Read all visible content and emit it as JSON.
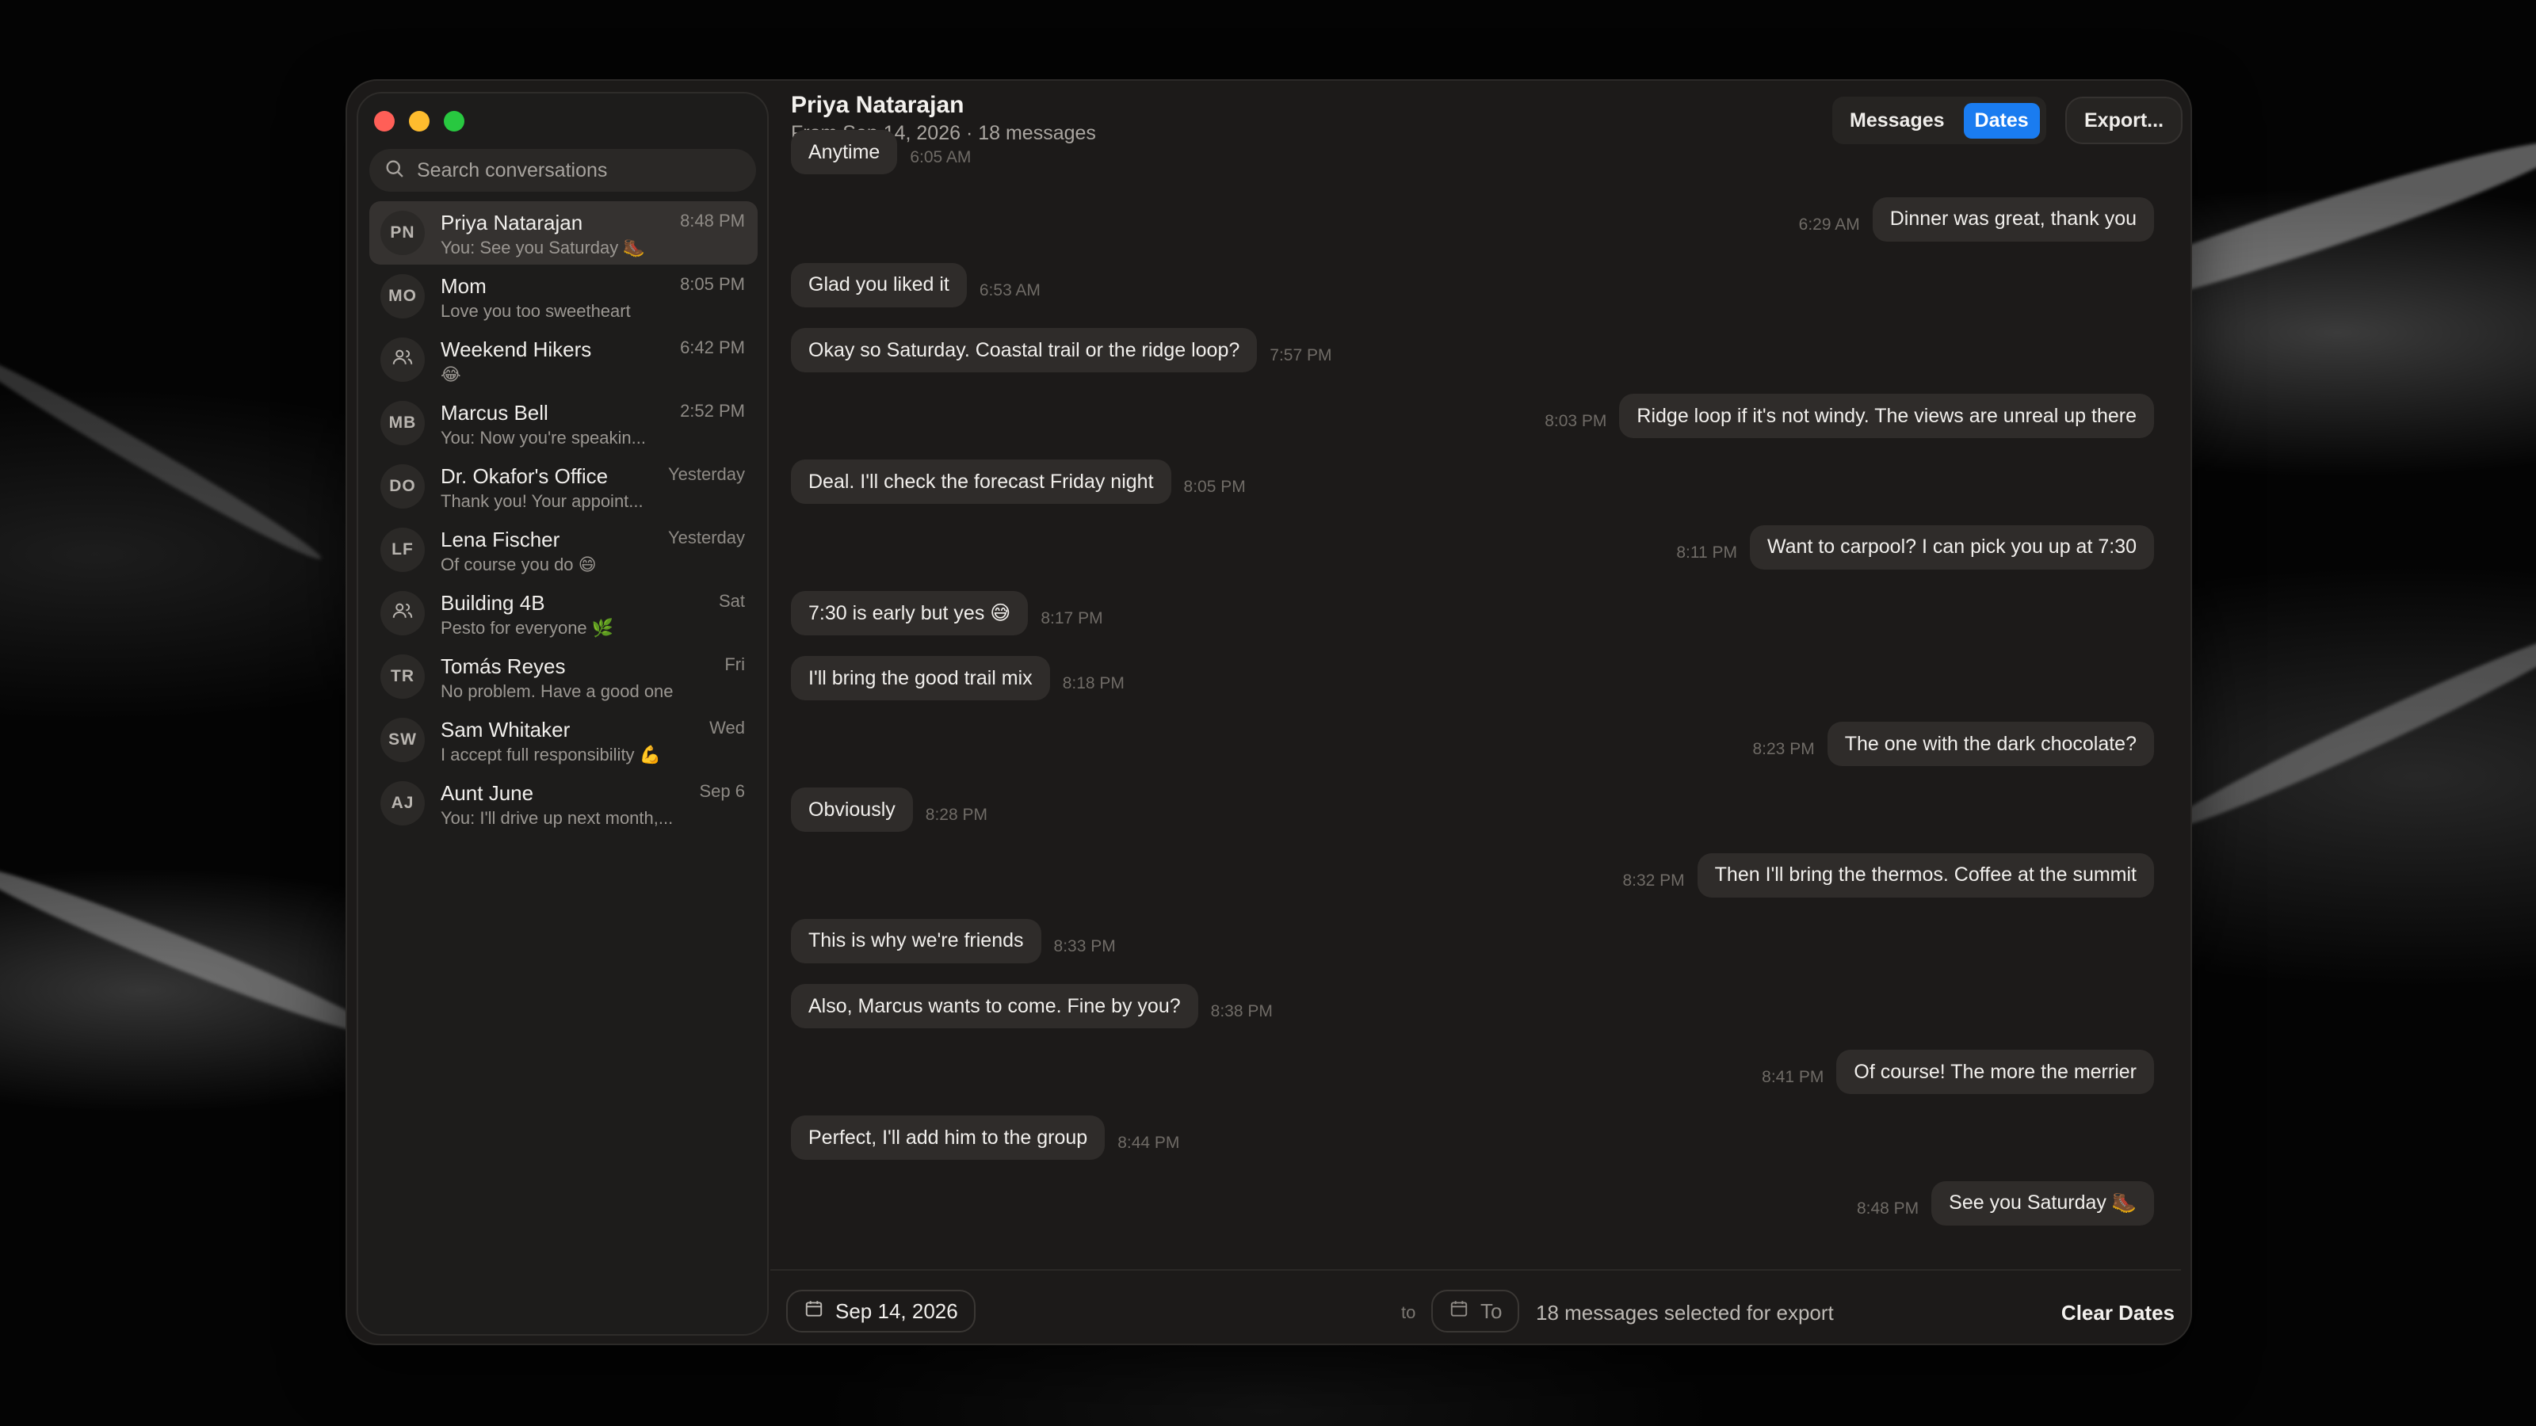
{
  "sidebar": {
    "search_placeholder": "Search conversations",
    "conversations": [
      {
        "initials": "PN",
        "name": "Priya Natarajan",
        "time": "8:48 PM",
        "preview": "You: See you Saturday 🥾",
        "active": true,
        "group": false
      },
      {
        "initials": "MO",
        "name": "Mom",
        "time": "8:05 PM",
        "preview": "Love you too sweetheart",
        "group": false
      },
      {
        "initials": "",
        "name": "Weekend Hikers",
        "time": "6:42 PM",
        "preview": "😂",
        "group": true
      },
      {
        "initials": "MB",
        "name": "Marcus Bell",
        "time": "2:52 PM",
        "preview": "You: Now you're speakin...",
        "group": false
      },
      {
        "initials": "DO",
        "name": "Dr. Okafor's Office",
        "time": "Yesterday",
        "preview": "Thank you! Your appoint...",
        "group": false
      },
      {
        "initials": "LF",
        "name": "Lena Fischer",
        "time": "Yesterday",
        "preview": "Of course you do 😄",
        "group": false
      },
      {
        "initials": "",
        "name": "Building 4B",
        "time": "Sat",
        "preview": "Pesto for everyone 🌿",
        "group": true
      },
      {
        "initials": "TR",
        "name": "Tomás Reyes",
        "time": "Fri",
        "preview": "No problem. Have a good one",
        "group": false
      },
      {
        "initials": "SW",
        "name": "Sam Whitaker",
        "time": "Wed",
        "preview": "I accept full responsibility 💪",
        "group": false
      },
      {
        "initials": "AJ",
        "name": "Aunt June",
        "time": "Sep 6",
        "preview": "You: I'll drive up next month,...",
        "group": false
      }
    ]
  },
  "header": {
    "title": "Priya Natarajan",
    "subtitle": "From Sep 14, 2026 · 18 messages",
    "tab_messages": "Messages",
    "tab_dates": "Dates",
    "export_label": "Export..."
  },
  "messages": [
    {
      "dir": "in",
      "text": "Anytime",
      "time": "6:05 AM"
    },
    {
      "dir": "out",
      "text": "Dinner was great, thank you",
      "time": "6:29 AM"
    },
    {
      "dir": "in",
      "text": "Glad you liked it",
      "time": "6:53 AM"
    },
    {
      "dir": "in",
      "text": "Okay so Saturday. Coastal trail or the ridge loop?",
      "time": "7:57 PM"
    },
    {
      "dir": "out",
      "text": "Ridge loop if it's not windy. The views are unreal up there",
      "time": "8:03 PM"
    },
    {
      "dir": "in",
      "text": "Deal. I'll check the forecast Friday night",
      "time": "8:05 PM"
    },
    {
      "dir": "out",
      "text": "Want to carpool? I can pick you up at 7:30",
      "time": "8:11 PM"
    },
    {
      "dir": "in",
      "text": "7:30 is early but yes 😅",
      "time": "8:17 PM"
    },
    {
      "dir": "in",
      "text": "I'll bring the good trail mix",
      "time": "8:18 PM"
    },
    {
      "dir": "out",
      "text": "The one with the dark chocolate?",
      "time": "8:23 PM"
    },
    {
      "dir": "in",
      "text": "Obviously",
      "time": "8:28 PM"
    },
    {
      "dir": "out",
      "text": "Then I'll bring the thermos. Coffee at the summit",
      "time": "8:32 PM"
    },
    {
      "dir": "in",
      "text": "This is why we're friends",
      "time": "8:33 PM"
    },
    {
      "dir": "in",
      "text": "Also, Marcus wants to come. Fine by you?",
      "time": "8:38 PM"
    },
    {
      "dir": "out",
      "text": "Of course! The more the merrier",
      "time": "8:41 PM"
    },
    {
      "dir": "in",
      "text": "Perfect, I'll add him to the group",
      "time": "8:44 PM"
    },
    {
      "dir": "out",
      "text": "See you Saturday 🥾",
      "time": "8:48 PM"
    }
  ],
  "footer": {
    "from_date": "Sep 14, 2026",
    "to_word": "to",
    "to_placeholder": "To",
    "selected_text": "18 messages selected for export",
    "clear_label": "Clear Dates"
  },
  "colors": {
    "accent": "#1a7cf0",
    "close": "#ff5f57",
    "minimize": "#febc2e",
    "zoom": "#28c840"
  }
}
